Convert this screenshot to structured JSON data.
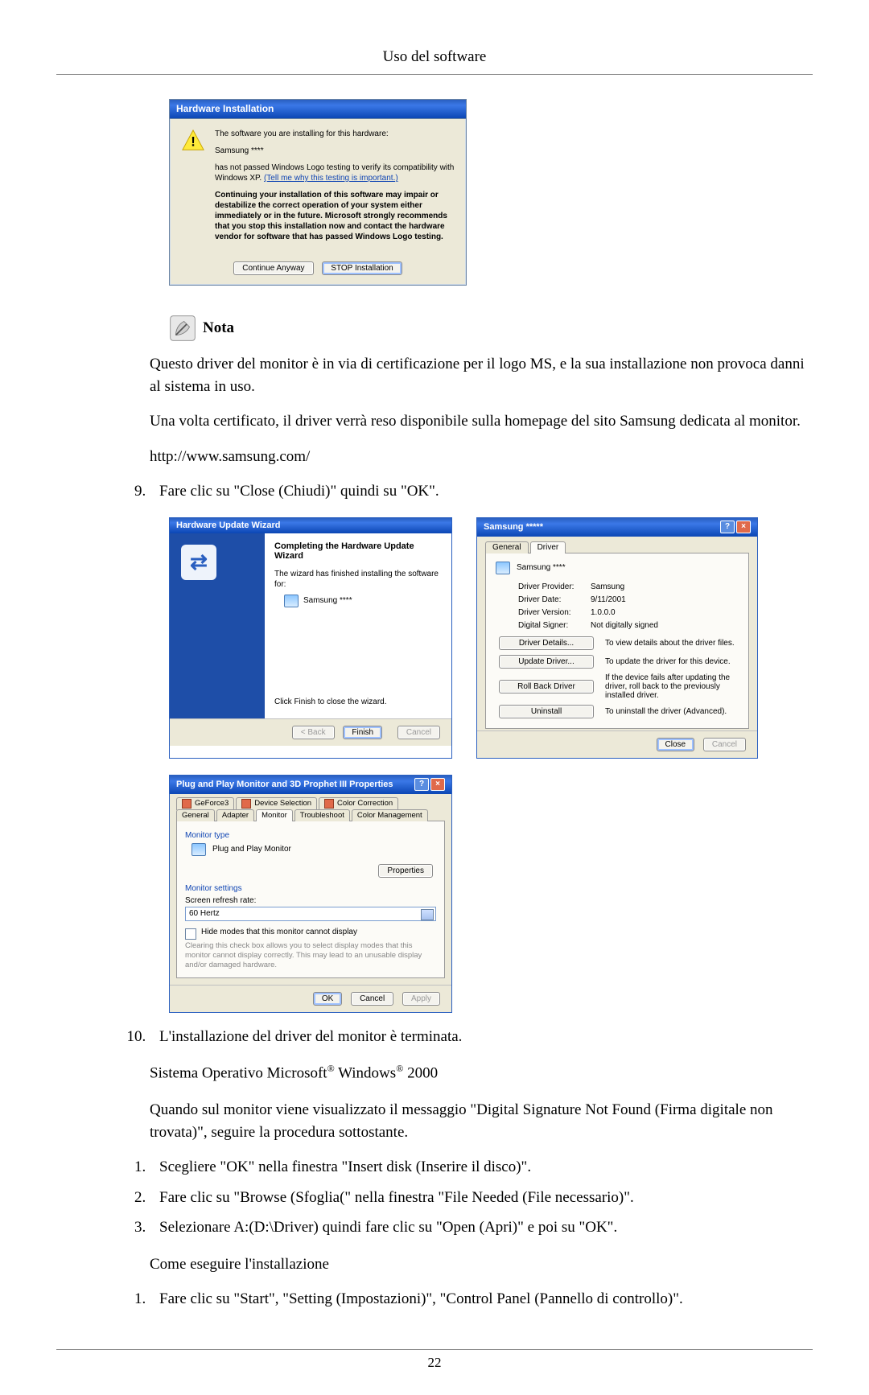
{
  "header": "Uso del software",
  "footer_page": "22",
  "dialog1": {
    "title": "Hardware Installation",
    "line_intro": "The software you are installing for this hardware:",
    "device": "Samsung ****",
    "notpassed": "has not passed Windows Logo testing to verify its compatibility with Windows XP.",
    "tellme": "(Tell me why this testing is important.)",
    "warning": "Continuing your installation of this software may impair or destabilize the correct operation of your system either immediately or in the future. Microsoft strongly recommends that you stop this installation now and contact the hardware vendor for software that has passed Windows Logo testing.",
    "btn_continue": "Continue Anyway",
    "btn_stop": "STOP Installation"
  },
  "nota": {
    "label": "Nota",
    "p1": "Questo driver del monitor è in via di certificazione per il logo MS, e la sua installazione non provoca danni al sistema in uso.",
    "p2": "Una volta certificato, il driver verrà reso disponibile sulla homepage del sito Samsung dedicata al monitor.",
    "p3": "http://www.samsung.com/"
  },
  "step9": "Fare clic su \"Close (Chiudi)\" quindi su \"OK\".",
  "dialog2": {
    "title": "Hardware Update Wizard",
    "heading": "Completing the Hardware Update Wizard",
    "line1": "The wizard has finished installing the software for:",
    "device": "Samsung ****",
    "finish_hint": "Click Finish to close the wizard.",
    "btn_back": "< Back",
    "btn_finish": "Finish",
    "btn_cancel": "Cancel"
  },
  "dialog3": {
    "title": "Samsung *****",
    "tab_general": "General",
    "tab_driver": "Driver",
    "device": "Samsung ****",
    "kv": {
      "provider_k": "Driver Provider:",
      "provider_v": "Samsung",
      "date_k": "Driver Date:",
      "date_v": "9/11/2001",
      "version_k": "Driver Version:",
      "version_v": "1.0.0.0",
      "signer_k": "Digital Signer:",
      "signer_v": "Not digitally signed"
    },
    "btn_details": "Driver Details...",
    "desc_details": "To view details about the driver files.",
    "btn_update": "Update Driver...",
    "desc_update": "To update the driver for this device.",
    "btn_rollback": "Roll Back Driver",
    "desc_rollback": "If the device fails after updating the driver, roll back to the previously installed driver.",
    "btn_uninstall": "Uninstall",
    "desc_uninstall": "To uninstall the driver (Advanced).",
    "btn_close": "Close",
    "btn_cancel": "Cancel"
  },
  "dialog4": {
    "title": "Plug and Play Monitor and 3D Prophet III Properties",
    "tabs": {
      "geforce3": "GeForce3",
      "device_sel": "Device Selection",
      "color_corr": "Color Correction",
      "general": "General",
      "adapter": "Adapter",
      "monitor": "Monitor",
      "troubleshoot": "Troubleshoot",
      "color_mgmt": "Color Management"
    },
    "group_monitor_type": "Monitor type",
    "monitor_type_value": "Plug and Play Monitor",
    "btn_properties": "Properties",
    "group_monitor_settings": "Monitor settings",
    "refresh_label": "Screen refresh rate:",
    "refresh_value": "60 Hertz",
    "hide_modes": "Hide modes that this monitor cannot display",
    "hide_modes_desc": "Clearing this check box allows you to select display modes that this monitor cannot display correctly. This may lead to an unusable display and/or damaged hardware.",
    "btn_ok": "OK",
    "btn_cancel": "Cancel",
    "btn_apply": "Apply"
  },
  "step10": "L'installazione del driver del monitor è terminata.",
  "os_line_prefix": "Sistema Operativo Microsoft",
  "os_windows": " Windows",
  "os_suffix": " 2000",
  "paragraph_dsnf": "Quando sul monitor viene visualizzato il messaggio \"Digital Signature Not Found (Firma digitale non trovata)\", seguire la procedura sottostante.",
  "list_a": {
    "i1": "Scegliere \"OK\" nella finestra \"Insert disk (Inserire il disco)\".",
    "i2": "Fare clic su \"Browse (Sfoglia(\" nella finestra \"File Needed (File necessario)\".",
    "i3": "Selezionare A:(D:\\Driver) quindi fare clic su \"Open (Apri)\" e poi su \"OK\"."
  },
  "howto_install": "Come eseguire l'installazione",
  "list_b": {
    "i1": "Fare clic su \"Start\", \"Setting (Impostazioni)\", \"Control Panel (Pannello di controllo)\"."
  }
}
